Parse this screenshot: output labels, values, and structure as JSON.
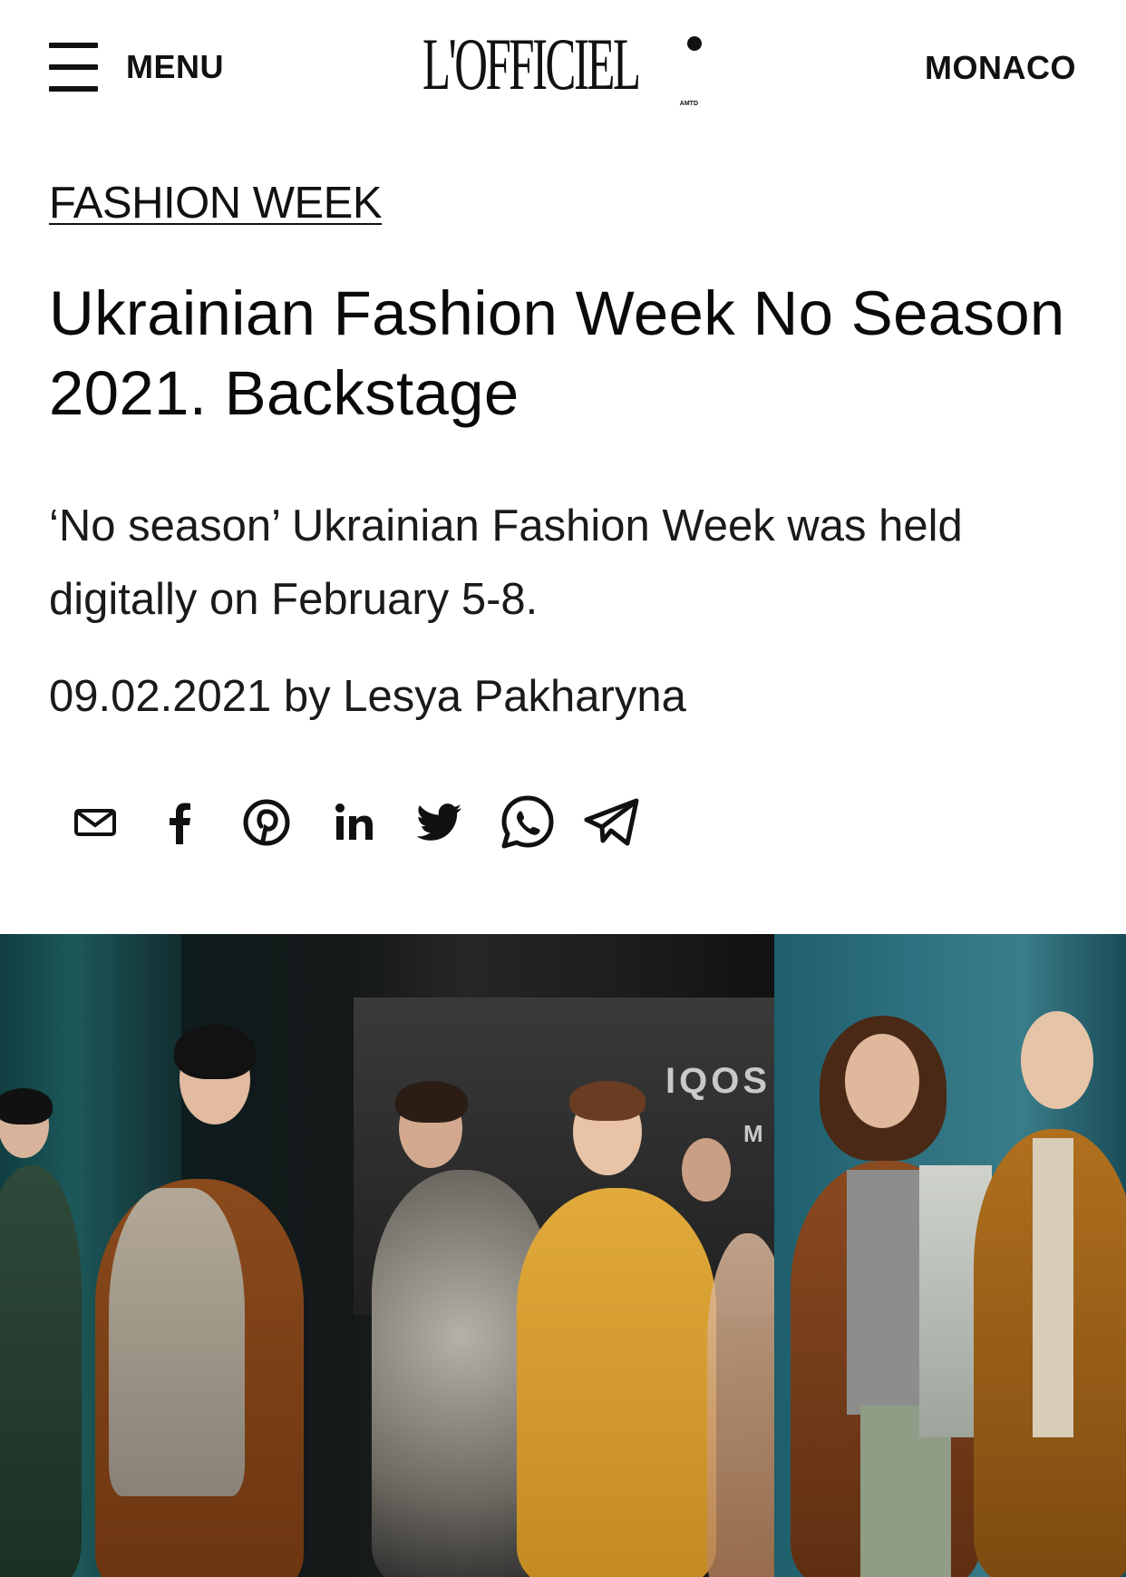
{
  "header": {
    "menu_label": "MENU",
    "logo_text": "L'OFFICIEL",
    "logo_subtext": "AMTD",
    "region_label": "MONACO"
  },
  "article": {
    "category": "FASHION WEEK",
    "title": "Ukrainian Fashion Week No Season 2021. Backstage",
    "lede": "‘No season’ Ukrainian Fashion Week was held digitally on February 5-8.",
    "meta": "09.02.2021 by Lesya Pakharyna"
  },
  "share": {
    "items": [
      {
        "name": "email",
        "icon": "mail-icon"
      },
      {
        "name": "facebook",
        "icon": "facebook-icon"
      },
      {
        "name": "pinterest",
        "icon": "pinterest-icon"
      },
      {
        "name": "linkedin",
        "icon": "linkedin-icon"
      },
      {
        "name": "twitter",
        "icon": "twitter-icon"
      },
      {
        "name": "whatsapp",
        "icon": "whatsapp-icon"
      },
      {
        "name": "telegram",
        "icon": "telegram-icon"
      }
    ]
  },
  "hero": {
    "wall_text_1": "IQOS",
    "wall_text_2": "M"
  },
  "colors": {
    "text": "#111111",
    "background": "#ffffff"
  }
}
